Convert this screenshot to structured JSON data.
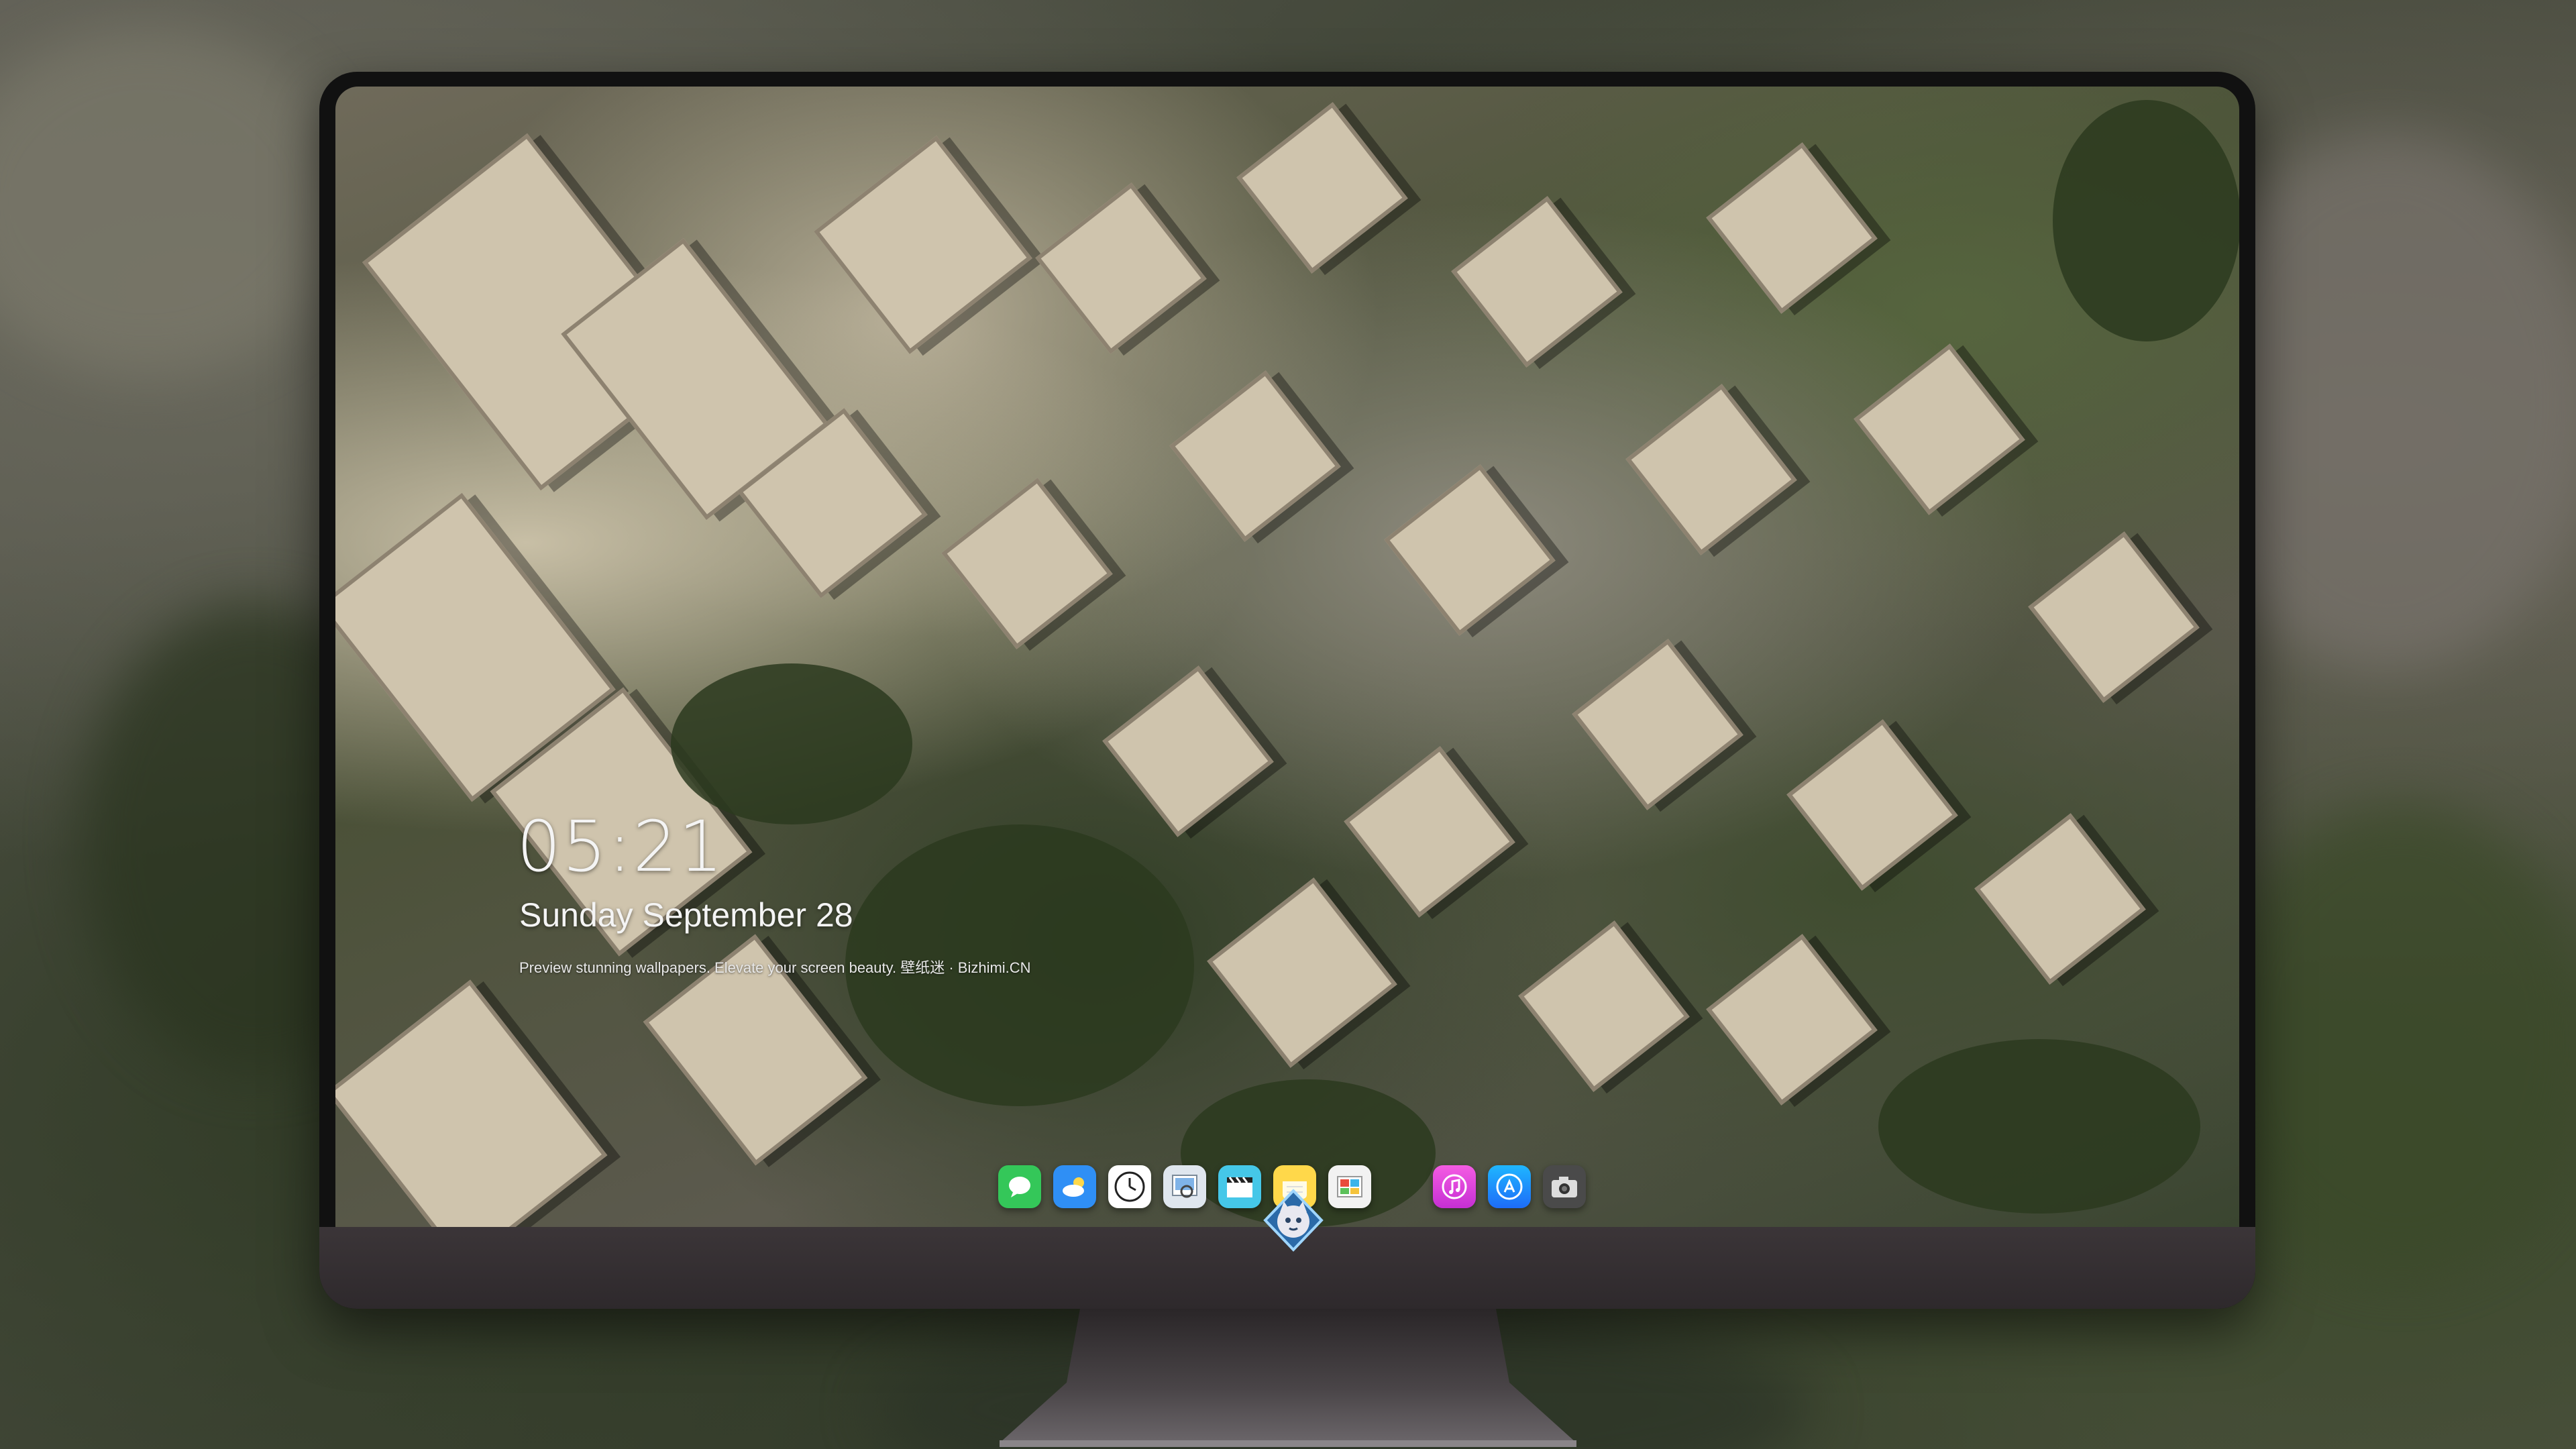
{
  "lockscreen": {
    "time": "05:21",
    "date": "Sunday September  28",
    "caption": "Preview stunning wallpapers. Elevate your screen beauty. 壁纸迷 · Bizhimi.CN"
  },
  "dock": {
    "apps": [
      {
        "name": "Messages",
        "icon": "messages-icon",
        "color": "#34c759"
      },
      {
        "name": "Weather",
        "icon": "weather-icon",
        "color": "#2f8ff5"
      },
      {
        "name": "Clock",
        "icon": "clock-icon",
        "color": "#ffffff"
      },
      {
        "name": "Preview",
        "icon": "preview-icon",
        "color": "#dfe6ee"
      },
      {
        "name": "Clips",
        "icon": "clips-icon",
        "color": "#45c7e8"
      },
      {
        "name": "Notes",
        "icon": "notes-icon",
        "color": "#ffd84a"
      },
      {
        "name": "Photos",
        "icon": "photos-icon",
        "color": "#f2f2f2"
      },
      {
        "name": "iTunes",
        "icon": "music-icon",
        "color": "#e23fd8"
      },
      {
        "name": "App Store",
        "icon": "app-store-icon",
        "color": "#1d8cf8"
      },
      {
        "name": "Camera",
        "icon": "camera-icon",
        "color": "#4a4a4a"
      }
    ]
  },
  "colors": {
    "monitor_bezel": "#111111",
    "monitor_chin": "#352f32",
    "stand": "#3d3a3d"
  }
}
